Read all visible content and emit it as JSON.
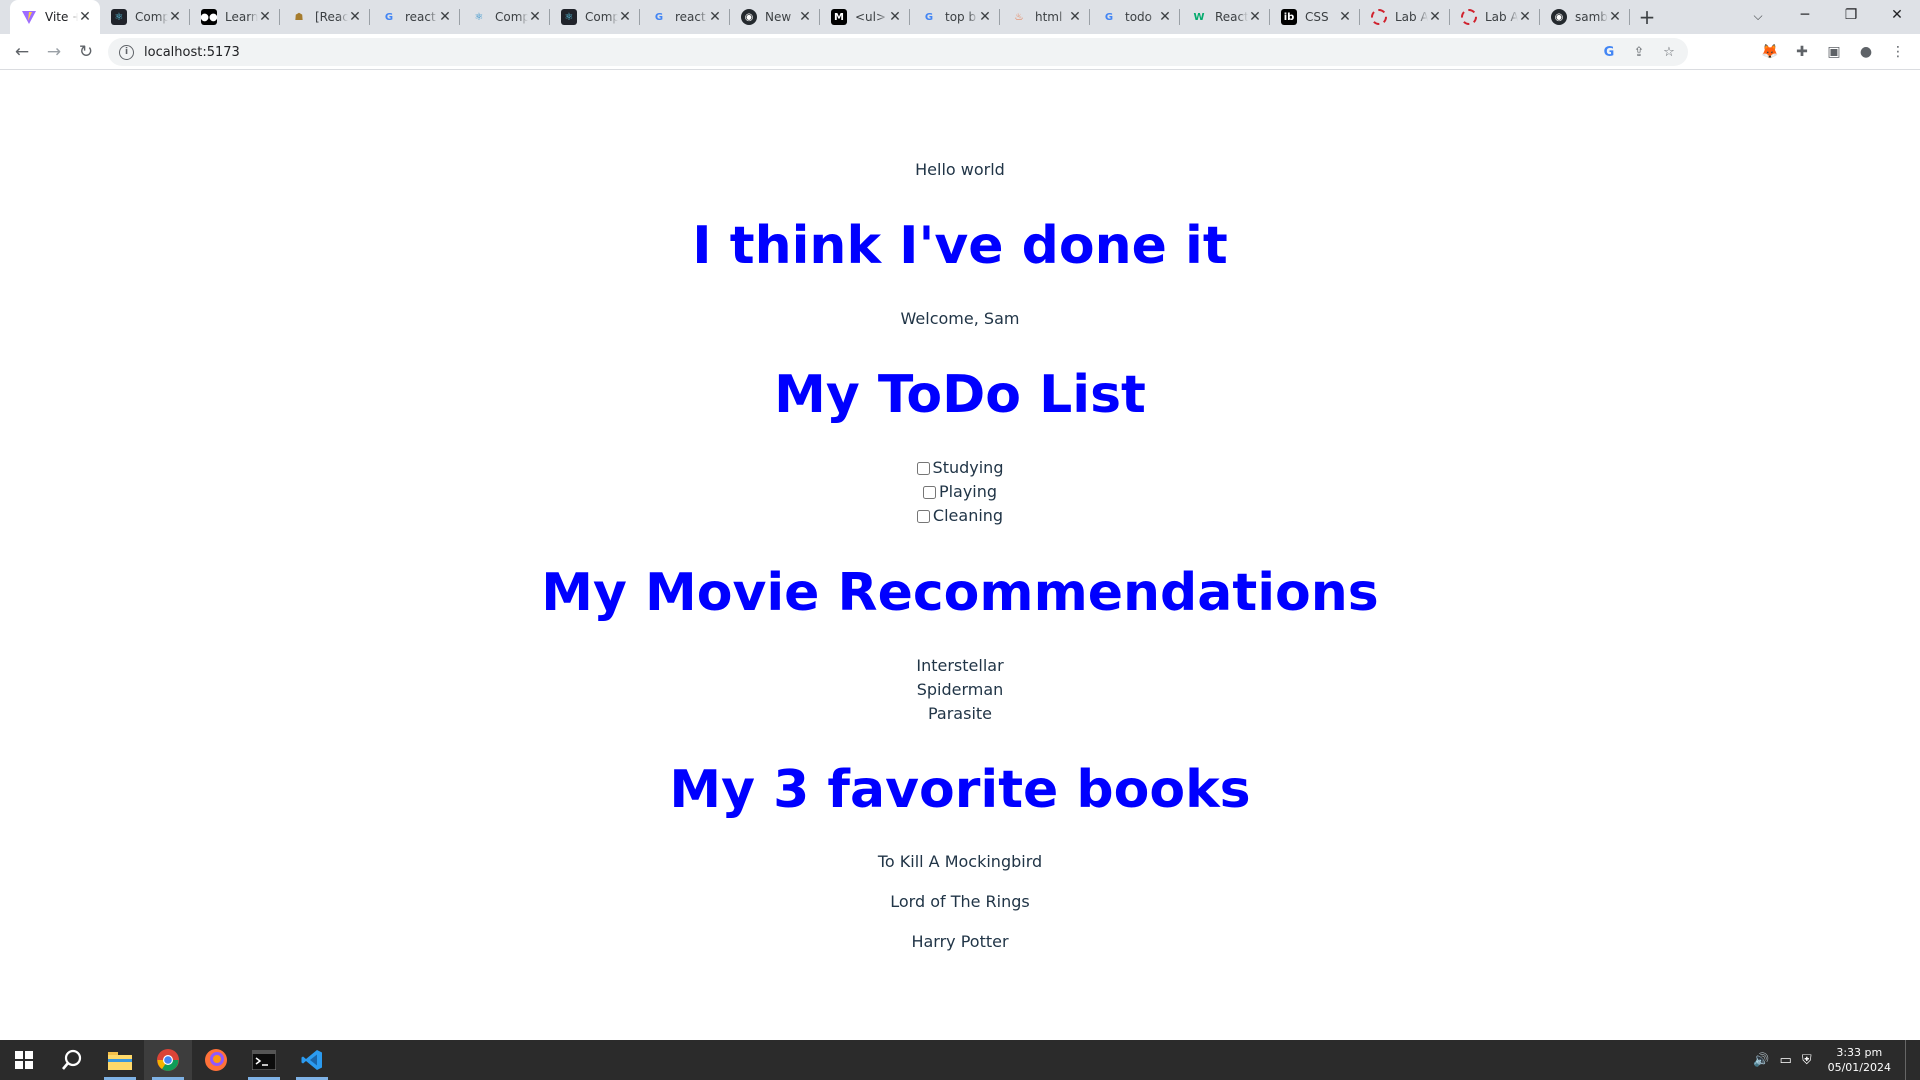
{
  "browser": {
    "tabs": [
      {
        "title": "Vite + React",
        "favicon": "vite-icon",
        "active": true
      },
      {
        "title": "Components",
        "favicon": "react-icon"
      },
      {
        "title": "Learn",
        "favicon": "medium-icon"
      },
      {
        "title": "[React]",
        "favicon": "stack-icon"
      },
      {
        "title": "react",
        "favicon": "google-icon"
      },
      {
        "title": "Components",
        "favicon": "react-icon"
      },
      {
        "title": "Components",
        "favicon": "react-icon"
      },
      {
        "title": "react",
        "favicon": "google-icon"
      },
      {
        "title": "New",
        "favicon": "github-icon"
      },
      {
        "title": "<ul>",
        "favicon": "mdn-icon"
      },
      {
        "title": "top b",
        "favicon": "google-icon"
      },
      {
        "title": "html",
        "favicon": "w3-icon"
      },
      {
        "title": "todo",
        "favicon": "google-icon"
      },
      {
        "title": "React",
        "favicon": "w3schools-icon"
      },
      {
        "title": "CSS",
        "favicon": "ib-icon"
      },
      {
        "title": "Lab A",
        "favicon": "lab-icon"
      },
      {
        "title": "Lab A",
        "favicon": "lab-icon"
      },
      {
        "title": "samb",
        "favicon": "github-icon"
      }
    ],
    "url": "localhost:5173"
  },
  "page": {
    "hello": "Hello world",
    "heading_done": "I think I've done it",
    "welcome": "Welcome, Sam",
    "heading_todo": "My ToDo List",
    "todos": [
      "Studying",
      "Playing",
      "Cleaning"
    ],
    "heading_movies": "My Movie Recommendations",
    "movies": [
      "Interstellar",
      "Spiderman",
      "Parasite"
    ],
    "heading_books": "My 3 favorite books",
    "books": [
      "To Kill A Mockingbird",
      "Lord of The Rings",
      "Harry Potter"
    ]
  },
  "taskbar": {
    "time": "3:33 pm",
    "date": "05/01/2024"
  },
  "colors": {
    "heading": "#0000ff",
    "body_text": "#213547",
    "tab_strip": "#dee1e6",
    "taskbar": "#2b2b2b"
  }
}
